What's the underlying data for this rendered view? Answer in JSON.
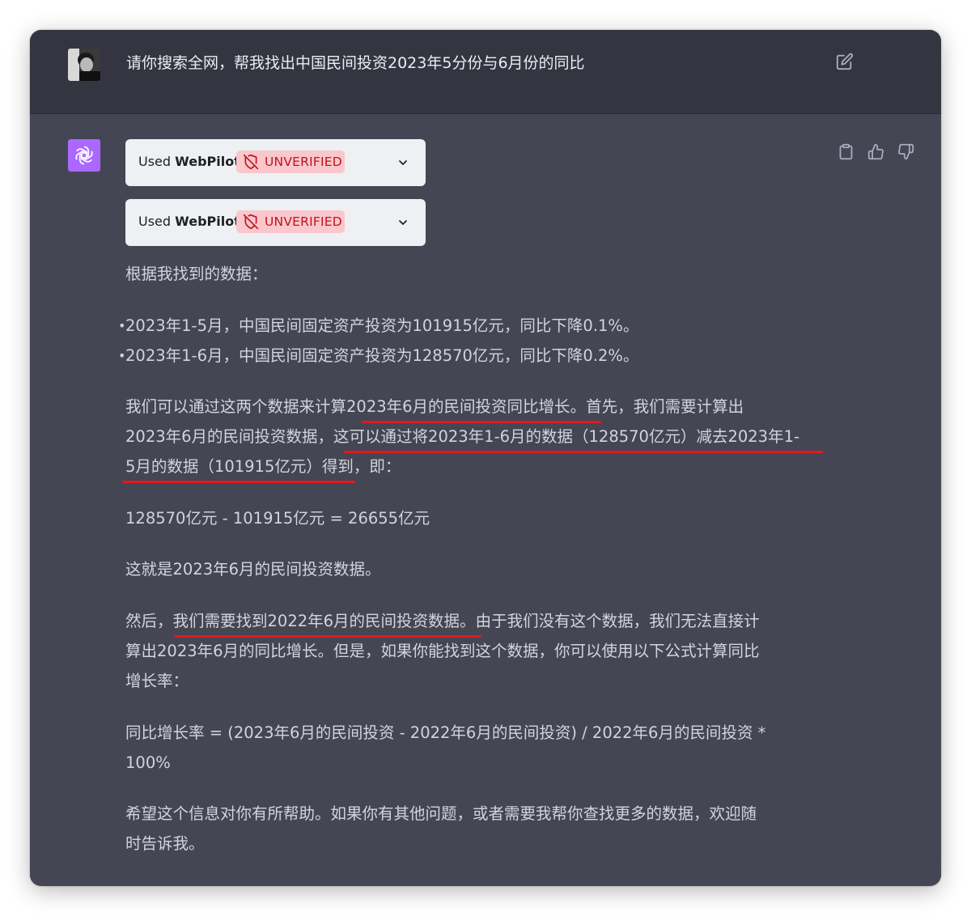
{
  "user": {
    "message": "请你搜索全网，帮我找出中国民间投资2023年5分份与6月份的同比",
    "avatar_icon": "user-avatar",
    "edit_icon": "edit-icon"
  },
  "assistant": {
    "avatar_icon": "openai-logo-icon",
    "plugins": [
      {
        "used_label": "Used",
        "name": "WebPilot",
        "badge": "UNVERIFIED"
      },
      {
        "used_label": "Used",
        "name": "WebPilot",
        "badge": "UNVERIFIED"
      }
    ],
    "actions": [
      "copy-icon",
      "thumbs-up-icon",
      "thumbs-down-icon"
    ],
    "intro": "根据我找到的数据：",
    "bullets": [
      "2023年1-5月，中国民间固定资产投资为101915亿元，同比下降0.1%。",
      "2023年1-6月，中国民间固定资产投资为128570亿元，同比下降0.2%。"
    ],
    "p1": {
      "l1a": "我们可以通过这两个数据来计算",
      "l1b": "2023年6月的民间投资同比增长",
      "l1c": "。首先，我们需要计算出",
      "l2a": "2023年6月的民间投资数据，",
      "l2b": "这可以通过将2023年1-6月的数据（128570亿元）减去2023年1-",
      "l3a": "5月的数据（101915亿元）得到",
      "l3b": "，即："
    },
    "equation": "128570亿元 - 101915亿元 = 26655亿元",
    "p2": "这就是2023年6月的民间投资数据。",
    "p3": {
      "l1a": "然后，",
      "l1b": "我们需要找到2022年6月的民间投资数据",
      "l1c": "。由于我们没有这个数据，我们无法直接计",
      "l2": "算出2023年6月的同比增长。但是，如果你能找到这个数据，你可以使用以下公式计算同比",
      "l3": "增长率："
    },
    "formula": {
      "l1": "同比增长率 = (2023年6月的民间投资 - 2022年6月的民间投资) / 2022年6月的民间投资 *",
      "l2": "100%"
    },
    "closing": {
      "l1": "希望这个信息对你有所帮助。如果你有其他问题，或者需要我帮你查找更多的数据，欢迎随",
      "l2": "时告诉我。"
    }
  },
  "colors": {
    "user_bg": "#343541",
    "assistant_bg": "#444654",
    "text": "#d1d5db",
    "badge_bg": "#f9c7cc",
    "badge_text": "#c0141d",
    "underline": "#e3181e",
    "gpt_avatar": "#ab68ff"
  }
}
